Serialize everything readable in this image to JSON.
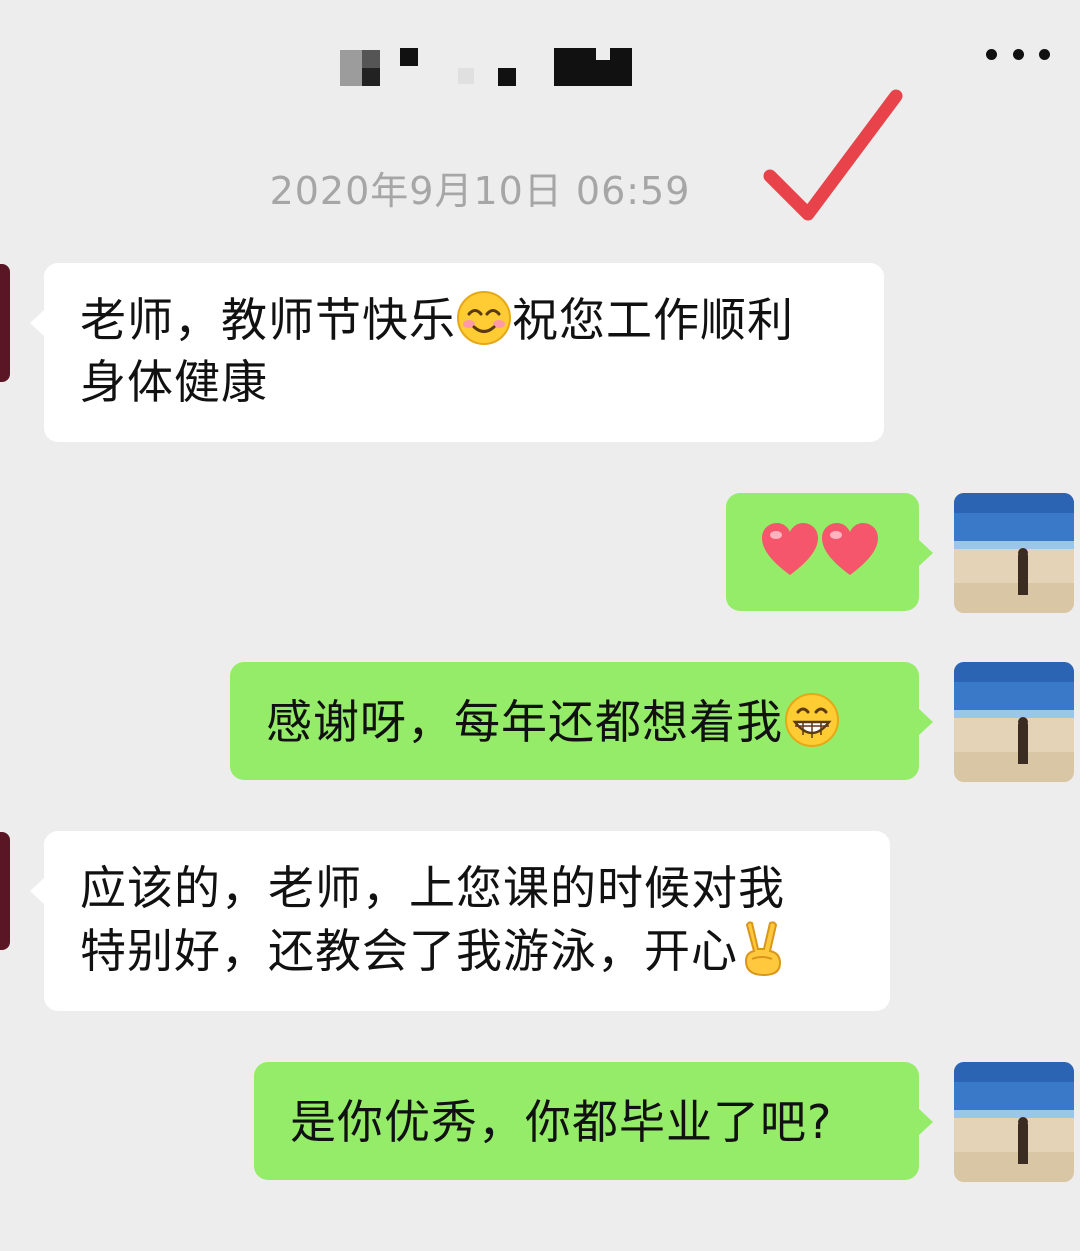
{
  "header": {
    "more_icon": "more-dots-icon"
  },
  "chat": {
    "timestamp": "2020年9月10日 06:59",
    "annotation": {
      "icon": "red-checkmark-icon",
      "color": "#e8434a"
    },
    "messages": [
      {
        "side": "left",
        "line1": "老师，教师节快乐",
        "emoji": "smiling-face-icon",
        "line1_after": "祝您工作顺利",
        "line2": "身体健康"
      },
      {
        "side": "right",
        "emojis": [
          "heart-icon",
          "heart-icon"
        ]
      },
      {
        "side": "right",
        "text": "感谢呀，每年还都想着我",
        "emoji": "grinning-face-icon"
      },
      {
        "side": "left",
        "line1": "应该的，老师，上您课的时候对我",
        "line2": "特别好，还教会了我游泳，开心",
        "emoji": "victory-hand-icon"
      },
      {
        "side": "right",
        "text": "是你优秀，你都毕业了吧?"
      }
    ]
  },
  "colors": {
    "background": "#ededed",
    "sent_bubble": "#95ec69",
    "received_bubble": "#ffffff",
    "timestamp": "#a6a6a6"
  }
}
